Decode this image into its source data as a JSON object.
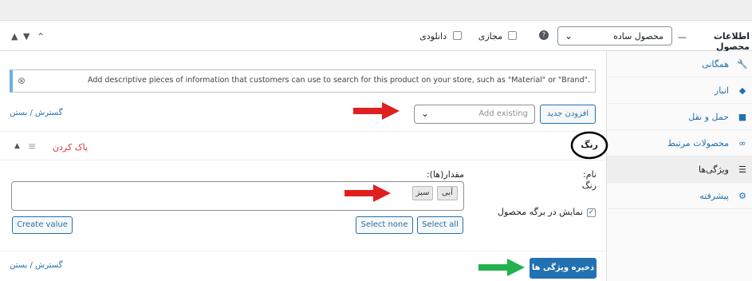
{
  "header": {
    "title": "اطلاعات محصول",
    "dash": "—",
    "product_type": "محصول ساده",
    "help": "?",
    "virtual_label": "مجازی",
    "download_label": "دانلودی"
  },
  "sidebar": {
    "items": [
      {
        "label": "همگانی",
        "icon": "wrench-icon"
      },
      {
        "label": "انبار",
        "icon": "tag-icon"
      },
      {
        "label": "حمل و نقل",
        "icon": "truck-icon"
      },
      {
        "label": "محصولات مرتبط",
        "icon": "link-icon"
      },
      {
        "label": "ویژگی‌ها",
        "icon": "list-icon"
      },
      {
        "label": "پیشرفته",
        "icon": "gear-icon"
      }
    ]
  },
  "notice": {
    "text": "Add descriptive pieces of information that customers can use to search for this product on your store, such as \"Material\" or \"Brand\".",
    "close": "⊗"
  },
  "toolbar": {
    "expand_collapse": "گسترش / بستن",
    "add_existing_placeholder": "Add existing",
    "add_new_label": "افزودن جدید"
  },
  "attribute": {
    "name": "رنگ",
    "remove_label": "پاک کردن",
    "name_label": "نام:",
    "name_value": "رنگ",
    "values_label": "مقدار(ها):",
    "values": [
      "آبی",
      "سبز"
    ],
    "show_on_page_label": "نمایش در برگه محصول",
    "select_all": "Select all",
    "select_none": "Select none",
    "create_value": "Create value"
  },
  "footer": {
    "expand_collapse": "گسترش / بستن",
    "save_label": "ذخیره ویژگی ها"
  },
  "colors": {
    "accent": "#2271b1",
    "danger": "#d63638",
    "arrow_red": "#e02020",
    "arrow_green": "#22b14c"
  }
}
